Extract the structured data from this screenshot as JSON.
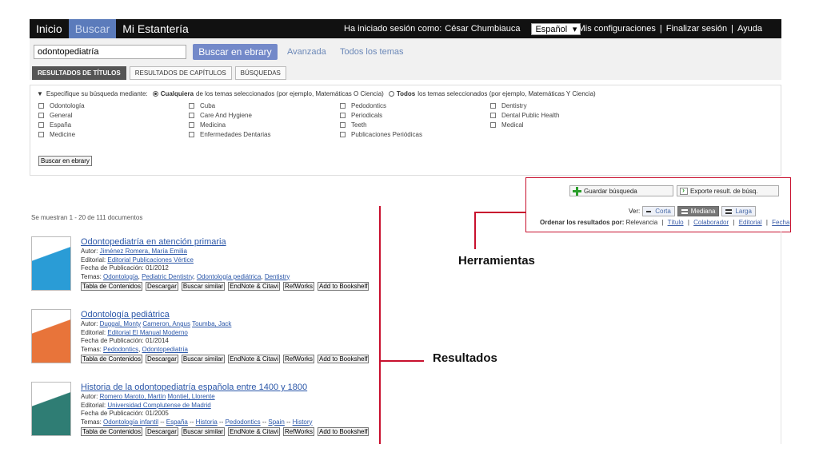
{
  "topnav": {
    "tabs": [
      "Inicio",
      "Buscar",
      "Mi Estantería"
    ],
    "active_tab": "Buscar",
    "session_label": "Ha iniciado sesión como:",
    "user_name": "César Chumbiauca",
    "language": "Español",
    "links": [
      "Mis configuraciones",
      "Finalizar sesión",
      "Ayuda"
    ]
  },
  "search": {
    "query": "odontopediatría",
    "button_label": "Buscar en ebrary",
    "advanced_link": "Avanzada",
    "all_topics_link": "Todos los temas"
  },
  "subtabs": [
    "RESULTADOS DE TÍTULOS",
    "RESULTADOS DE CAPÍTULOS",
    "BÚSQUEDAS"
  ],
  "filters": {
    "prefix": "Especifique su búsqueda mediante:",
    "option_any_bold": "Cualquiera",
    "option_any_rest": "de los temas seleccionados (por ejemplo, Matemáticas O Ciencia)",
    "option_all_bold": "Todos",
    "option_all_rest": "los temas seleccionados (por ejemplo, Matemáticas Y Ciencia)",
    "topics": [
      "Odontología",
      "Cuba",
      "Pedodontics",
      "Dentistry",
      "General",
      "Care And Hygiene",
      "Periodicals",
      "Dental Public Health",
      "España",
      "Medicina",
      "Teeth",
      "Medical",
      "Medicine",
      "Enfermedades Dentarias",
      "Publicaciones Periódicas",
      ""
    ],
    "button_label": "Buscar en ebrary"
  },
  "results_count": "Se muestran 1 - 20 de 111 documentos",
  "tools": {
    "save_label": "Guardar búsqueda",
    "export_label": "Exporte result. de búsq.",
    "ver_label": "Ver:",
    "view_short": "Corta",
    "view_medium": "Mediana",
    "view_long": "Larga",
    "sort_label": "Ordenar los resultados por:",
    "sort_current": "Relevancia",
    "sort_links": [
      "Título",
      "Colaborador",
      "Editorial",
      "Fecha"
    ]
  },
  "callouts": {
    "tools": "Herramientas",
    "results": "Resultados"
  },
  "result_labels": {
    "author": "Autor:",
    "publisher": "Editorial:",
    "date": "Fecha de Publicación:",
    "topics": "Temas:"
  },
  "actions": [
    "Tabla de Contenidos",
    "Descargar",
    "Buscar similar",
    "EndNote & Citavi",
    "RefWorks",
    "Add to Bookshelf"
  ],
  "results": [
    {
      "title": "Odontopediatría en atención primaria",
      "authors": [
        "Jiménez Romera, María Emilia"
      ],
      "publisher": "Editorial Publicaciones Vértice",
      "date": "01/2012",
      "topics_text": "",
      "topics": [
        "Odontología",
        "Pediatric Dentistry",
        "Odontología pediátrica",
        "Dentistry"
      ],
      "cover_color": "#2a9cd6"
    },
    {
      "title": "Odontología pediátrica",
      "authors": [
        "Duggal, Monty",
        "Cameron, Angus",
        "Toumba, Jack"
      ],
      "publisher": "Editorial El Manual Moderno",
      "date": "01/2014",
      "topics": [
        "Pedodontics",
        "Odontopediatría"
      ],
      "cover_color": "#e8743a"
    },
    {
      "title": "Historia de la odontopediatría española entre 1400 y 1800",
      "authors": [
        "Romero Maroto, Martín",
        "Montiel, Llorente"
      ],
      "publisher": "Universidad Complutense de Madrid",
      "date": "01/2005",
      "topics": [
        "Odontología infantil",
        "España",
        "Historia",
        "Pedodontics",
        "Spain",
        "History"
      ],
      "cover_color": "#2f7d74"
    }
  ]
}
